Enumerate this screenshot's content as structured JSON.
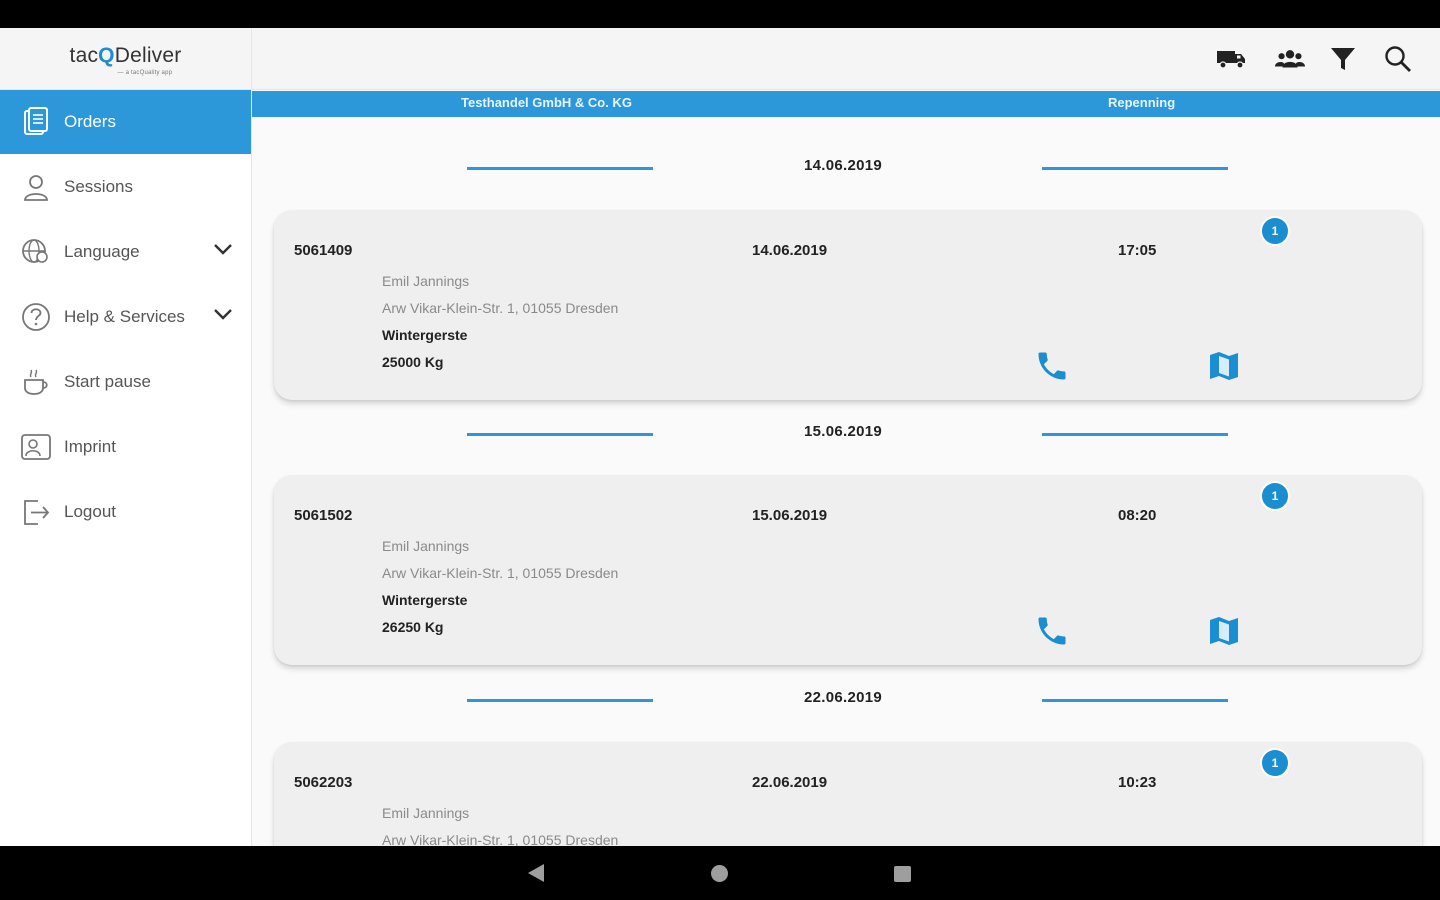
{
  "app": {
    "logo_prefix": "tac",
    "logo_q": "Q",
    "logo_suffix": "Deliver",
    "logo_sub": "— a tacQuality app"
  },
  "sidebar": {
    "items": [
      {
        "label": "Orders",
        "icon": "document-icon",
        "active": true
      },
      {
        "label": "Sessions",
        "icon": "person-icon"
      },
      {
        "label": "Language",
        "icon": "language-icon",
        "expandable": true
      },
      {
        "label": "Help & Services",
        "icon": "help-icon",
        "expandable": true
      },
      {
        "label": "Start pause",
        "icon": "coffee-cup-icon"
      },
      {
        "label": "Imprint",
        "icon": "imprint-icon"
      },
      {
        "label": "Logout",
        "icon": "logout-icon"
      }
    ]
  },
  "topbar": {
    "icons": [
      "truck-icon",
      "group-icon",
      "filter-icon",
      "search-icon"
    ]
  },
  "strip": {
    "company": "Testhandel GmbH & Co. KG",
    "location": "Repenning"
  },
  "colors": {
    "accent": "#2c97d9",
    "badge": "#1a8ed1"
  },
  "groups": [
    {
      "date": "14.06.2019",
      "order": {
        "number": "5061409",
        "date": "14.06.2019",
        "time": "17:05",
        "badge": "1",
        "name": "Emil Jannings",
        "address": "Arw Vikar-Klein-Str. 1, 01055 Dresden",
        "product": "Wintergerste",
        "weight": "25000 Kg"
      }
    },
    {
      "date": "15.06.2019",
      "order": {
        "number": "5061502",
        "date": "15.06.2019",
        "time": "08:20",
        "badge": "1",
        "name": "Emil Jannings",
        "address": "Arw Vikar-Klein-Str. 1, 01055 Dresden",
        "product": "Wintergerste",
        "weight": "26250 Kg"
      }
    },
    {
      "date": "22.06.2019",
      "order": {
        "number": "5062203",
        "date": "22.06.2019",
        "time": "10:23",
        "badge": "1",
        "name": "Emil Jannings",
        "address": "Arw Vikar-Klein-Str. 1, 01055 Dresden",
        "product": "",
        "weight": ""
      }
    }
  ]
}
